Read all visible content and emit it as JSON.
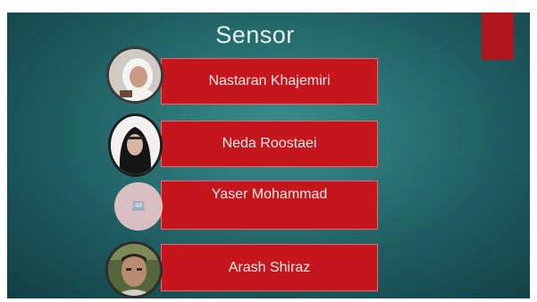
{
  "slide": {
    "title": "Sensor",
    "accent_color": "#c4161c"
  },
  "members": [
    {
      "name": "Nastaran Khajemiri",
      "avatar": "photo"
    },
    {
      "name": "Neda Roostaei",
      "avatar": "photo"
    },
    {
      "name": "Yaser Mohammad",
      "avatar": "placeholder-icon"
    },
    {
      "name": "Arash Shiraz",
      "avatar": "photo"
    }
  ]
}
